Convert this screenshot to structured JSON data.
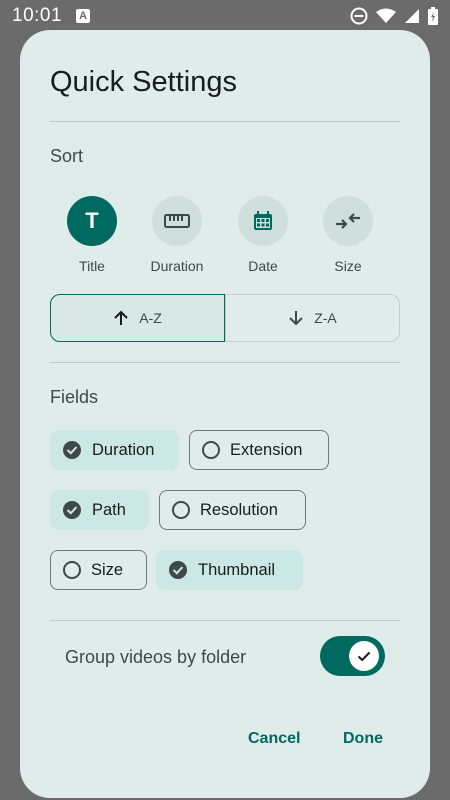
{
  "status_bar": {
    "time": "10:01",
    "notification_badge": "A",
    "icons": [
      "dnd-icon",
      "wifi-icon",
      "signal-icon",
      "battery-icon"
    ]
  },
  "dialog": {
    "title": "Quick Settings",
    "sort": {
      "label": "Sort",
      "options": [
        {
          "label": "Title",
          "icon": "title-T-icon",
          "selected": true
        },
        {
          "label": "Duration",
          "icon": "ruler-icon",
          "selected": false
        },
        {
          "label": "Date",
          "icon": "calendar-icon",
          "selected": false
        },
        {
          "label": "Size",
          "icon": "compress-icon",
          "selected": false
        }
      ],
      "order": [
        {
          "label": "A-Z",
          "icon": "arrow-up-icon",
          "selected": true
        },
        {
          "label": "Z-A",
          "icon": "arrow-down-icon",
          "selected": false
        }
      ]
    },
    "fields": {
      "label": "Fields",
      "chips": [
        {
          "label": "Duration",
          "checked": true
        },
        {
          "label": "Extension",
          "checked": false
        },
        {
          "label": "Path",
          "checked": true
        },
        {
          "label": "Resolution",
          "checked": false
        },
        {
          "label": "Size",
          "checked": false
        },
        {
          "label": "Thumbnail",
          "checked": true
        }
      ]
    },
    "group_toggle": {
      "label": "Group videos by folder",
      "on": true
    },
    "actions": {
      "cancel": "Cancel",
      "done": "Done"
    }
  },
  "colors": {
    "accent": "#006a60",
    "dialog_bg": "#e0ecea",
    "chip_checked_bg": "#cce8e4",
    "scrim": "#6b6b6b"
  }
}
